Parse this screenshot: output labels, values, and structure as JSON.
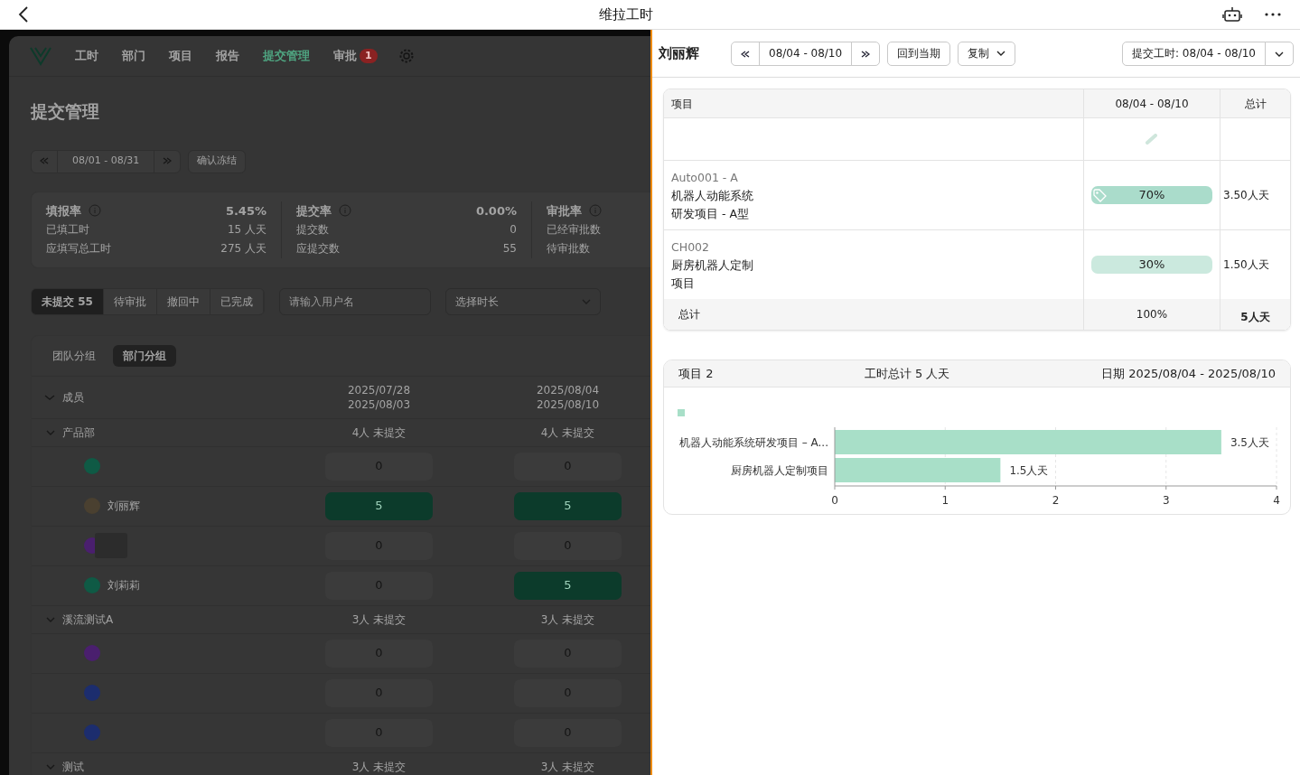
{
  "app_bar": {
    "title": "维拉工时"
  },
  "main": {
    "nav": [
      {
        "label": "工时",
        "selected": false
      },
      {
        "label": "部门",
        "selected": false
      },
      {
        "label": "项目",
        "selected": false
      },
      {
        "label": "报告",
        "selected": false
      },
      {
        "label": "提交管理",
        "selected": true
      },
      {
        "label": "审批",
        "selected": false,
        "badge": "1"
      }
    ],
    "page_title": "提交管理",
    "period": "08/01 - 08/31",
    "freeze_button": "确认冻结",
    "stats": [
      {
        "title": "填报率",
        "value": "5.45%",
        "rows": [
          {
            "label": "已填工时",
            "value": "15 人天"
          },
          {
            "label": "应填写总工时",
            "value": "275 人天"
          }
        ]
      },
      {
        "title": "提交率",
        "value": "0.00%",
        "rows": [
          {
            "label": "提交数",
            "value": "0"
          },
          {
            "label": "应提交数",
            "value": "55"
          }
        ]
      },
      {
        "title": "审批率",
        "rows": [
          {
            "label": "已经审批数"
          },
          {
            "label": "待审批数"
          }
        ]
      }
    ],
    "status_tabs": [
      {
        "label": "未提交 55",
        "selected": true
      },
      {
        "label": "待审批",
        "selected": false
      },
      {
        "label": "撤回中",
        "selected": false
      },
      {
        "label": "已完成",
        "selected": false
      }
    ],
    "user_search": {
      "placeholder": "请输入用户名"
    },
    "duration_select": {
      "placeholder": "选择时长"
    },
    "group_tabs": [
      {
        "label": "团队分组",
        "selected": false
      },
      {
        "label": "部门分组",
        "selected": true
      }
    ],
    "table": {
      "member_header": "成员",
      "periods": [
        [
          "2025/07/28",
          "2025/08/03"
        ],
        [
          "2025/08/04",
          "2025/08/10"
        ]
      ],
      "groups": [
        {
          "name": "产品部",
          "expanded": true,
          "summaries": [
            "4人 未提交",
            "4人 未提交"
          ],
          "members": [
            {
              "color": "#0f5a45",
              "cells": [
                {
                  "value": "0",
                  "submitted": false
                },
                {
                  "value": "0",
                  "submitted": false
                }
              ]
            },
            {
              "name": "刘丽辉",
              "color": "#4a4030",
              "cells": [
                {
                  "value": "5",
                  "submitted": true
                },
                {
                  "value": "5",
                  "submitted": true
                }
              ]
            },
            {
              "color": "#4a1f6e",
              "redacted": true,
              "cells": [
                {
                  "value": "0",
                  "submitted": false
                },
                {
                  "value": "0",
                  "submitted": false
                }
              ]
            },
            {
              "name": "刘莉莉",
              "color": "#0f5a45",
              "cells": [
                {
                  "value": "0",
                  "submitted": false
                },
                {
                  "value": "5",
                  "submitted": true
                }
              ]
            }
          ]
        },
        {
          "name": "溪流测试A",
          "expanded": true,
          "summaries": [
            "3人 未提交",
            "3人 未提交"
          ],
          "members": [
            {
              "color": "#4a1f6e",
              "cells": [
                {
                  "value": "0",
                  "submitted": false
                },
                {
                  "value": "0",
                  "submitted": false
                }
              ]
            },
            {
              "color": "#1c2d6e",
              "cells": [
                {
                  "value": "0",
                  "submitted": false
                },
                {
                  "value": "0",
                  "submitted": false
                }
              ]
            },
            {
              "color": "#1c2d6e",
              "cells": [
                {
                  "value": "0",
                  "submitted": false
                },
                {
                  "value": "0",
                  "submitted": false
                }
              ]
            }
          ]
        },
        {
          "name": "测试",
          "expanded": true,
          "summaries": [
            "3人 未提交",
            "3人 未提交"
          ]
        }
      ]
    }
  },
  "detail": {
    "person": "刘丽辉",
    "period": "08/04 - 08/10",
    "current_button": "回到当期",
    "copy_button": "复制",
    "submit_button": "提交工时: 08/04 - 08/10",
    "table": {
      "columns": [
        "项目",
        "08/04 - 08/10",
        "总计"
      ],
      "rows": [
        {
          "code": "Auto001 - A",
          "name_lines": [
            "机器人动能系统",
            "研发项目 - A型"
          ],
          "share": "70%",
          "tagged": true,
          "color": "#aadccb",
          "total": "3.50人天"
        },
        {
          "code": "CH002",
          "name_lines": [
            "厨房机器人定制",
            "项目"
          ],
          "share": "30%",
          "tagged": false,
          "color": "#cbe9de",
          "total": "1.50人天"
        }
      ],
      "footer": [
        "总计",
        "100%",
        "5人天"
      ]
    },
    "chart_card": {
      "count": "项目 2",
      "total": "工时总计 5 人天",
      "date": "日期 2025/08/04 - 2025/08/10",
      "chart_data": {
        "type": "bar",
        "orientation": "horizontal",
        "categories": [
          "机器人动能系统研发项目 – A...",
          "厨房机器人定制项目"
        ],
        "series": [
          {
            "color": "#a8dfc8",
            "values": [
              3.5,
              1.5
            ]
          }
        ],
        "grid": true,
        "xlim": [
          0,
          4
        ],
        "xticks": [
          0,
          1,
          2,
          3,
          4
        ],
        "value_labels": [
          "3.5人天",
          "1.5人天"
        ]
      }
    }
  }
}
